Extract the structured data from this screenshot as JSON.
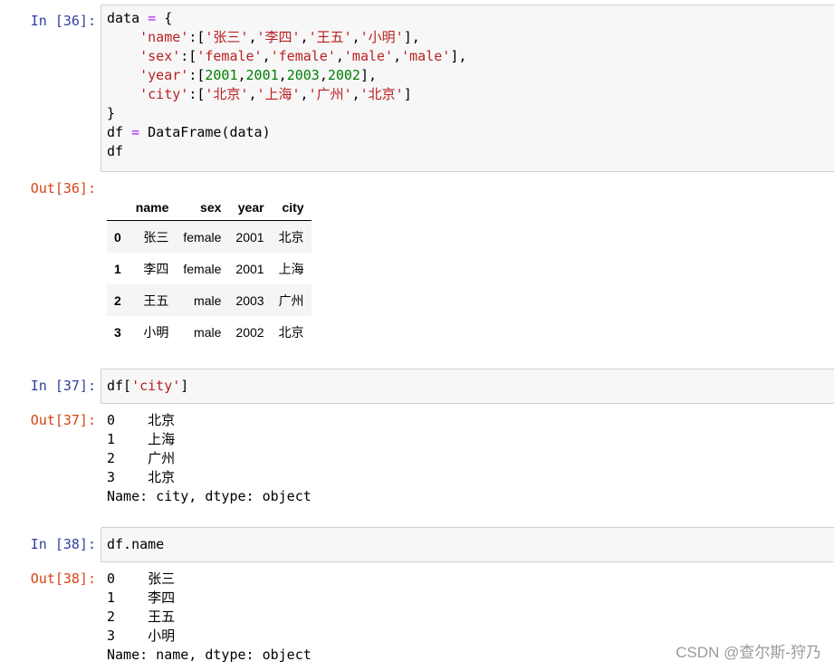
{
  "cells": [
    {
      "in_prompt": "In  [36]:",
      "out_prompt": "Out[36]:",
      "code_tokens": {
        "l1a": "data ",
        "l1op": "=",
        "l1b": " {",
        "l2a": "    ",
        "l2s1": "'name'",
        "l2b": ":[",
        "l2s2": "'张三'",
        "l2c": ",",
        "l2s3": "'李四'",
        "l2d": ",",
        "l2s4": "'王五'",
        "l2e": ",",
        "l2s5": "'小明'",
        "l2f": "],",
        "l3a": "    ",
        "l3s1": "'sex'",
        "l3b": ":[",
        "l3s2": "'female'",
        "l3c": ",",
        "l3s3": "'female'",
        "l3d": ",",
        "l3s4": "'male'",
        "l3e": ",",
        "l3s5": "'male'",
        "l3f": "],",
        "l4a": "    ",
        "l4s1": "'year'",
        "l4b": ":[",
        "l4n1": "2001",
        "l4c": ",",
        "l4n2": "2001",
        "l4d": ",",
        "l4n3": "2003",
        "l4e": ",",
        "l4n4": "2002",
        "l4f": "],",
        "l5a": "    ",
        "l5s1": "'city'",
        "l5b": ":[",
        "l5s2": "'北京'",
        "l5c": ",",
        "l5s3": "'上海'",
        "l5d": ",",
        "l5s4": "'广州'",
        "l5e": ",",
        "l5s5": "'北京'",
        "l5f": "]",
        "l6": "}",
        "l7a": "df ",
        "l7op": "=",
        "l7b": " DataFrame(data)",
        "l8": "df"
      },
      "dataframe": {
        "columns": [
          "name",
          "sex",
          "year",
          "city"
        ],
        "rows": [
          {
            "index": "0",
            "values": [
              "张三",
              "female",
              "2001",
              "北京"
            ]
          },
          {
            "index": "1",
            "values": [
              "李四",
              "female",
              "2001",
              "上海"
            ]
          },
          {
            "index": "2",
            "values": [
              "王五",
              "male",
              "2003",
              "广州"
            ]
          },
          {
            "index": "3",
            "values": [
              "小明",
              "male",
              "2002",
              "北京"
            ]
          }
        ]
      }
    },
    {
      "in_prompt": "In  [37]:",
      "out_prompt": "Out[37]:",
      "code_tokens": {
        "a": "df[",
        "s": "'city'",
        "b": "]"
      },
      "output_lines": [
        "0    北京",
        "1    上海",
        "2    广州",
        "3    北京",
        "Name: city, dtype: object"
      ]
    },
    {
      "in_prompt": "In  [38]:",
      "out_prompt": "Out[38]:",
      "code_tokens": {
        "a": "df.name"
      },
      "output_lines": [
        "0    张三",
        "1    李四",
        "2    王五",
        "3    小明",
        "Name: name, dtype: object"
      ]
    }
  ],
  "watermark": "CSDN @查尔斯-狩乃"
}
